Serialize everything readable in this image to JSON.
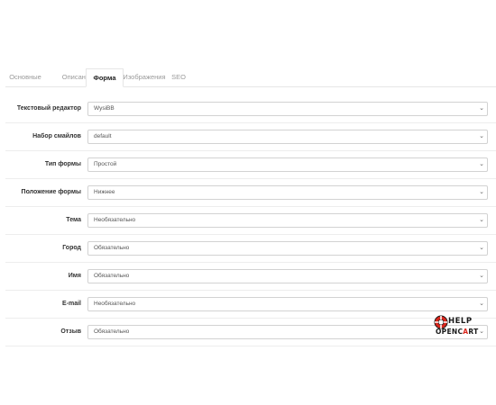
{
  "tabs": [
    {
      "label": "Основные"
    },
    {
      "label": "Описание"
    },
    {
      "label": "Форма"
    },
    {
      "label": "Изображения"
    },
    {
      "label": "SEO"
    }
  ],
  "active_tab": "Форма",
  "rows": [
    {
      "label": "Текстовый редактор",
      "value": "WysiBB"
    },
    {
      "label": "Набор смайлов",
      "value": "default"
    },
    {
      "label": "Тип формы",
      "value": "Простой"
    },
    {
      "label": "Положение формы",
      "value": "Нижнее"
    },
    {
      "label": "Тема",
      "value": "Необязательно"
    },
    {
      "label": "Город",
      "value": "Обязательно"
    },
    {
      "label": "Имя",
      "value": "Обязательно"
    },
    {
      "label": "E-mail",
      "value": "Необязательно"
    },
    {
      "label": "Отзыв",
      "value": "Обязательно"
    }
  ],
  "icons": {
    "select_chevron": "chevron-down-icon"
  },
  "logo": {
    "line1": "HELP",
    "line2a": "OPENC",
    "line2b": "A",
    "line2c": "RT"
  },
  "colors": {
    "logo_accent": "#d9261c",
    "border": "#d2d2d2"
  }
}
